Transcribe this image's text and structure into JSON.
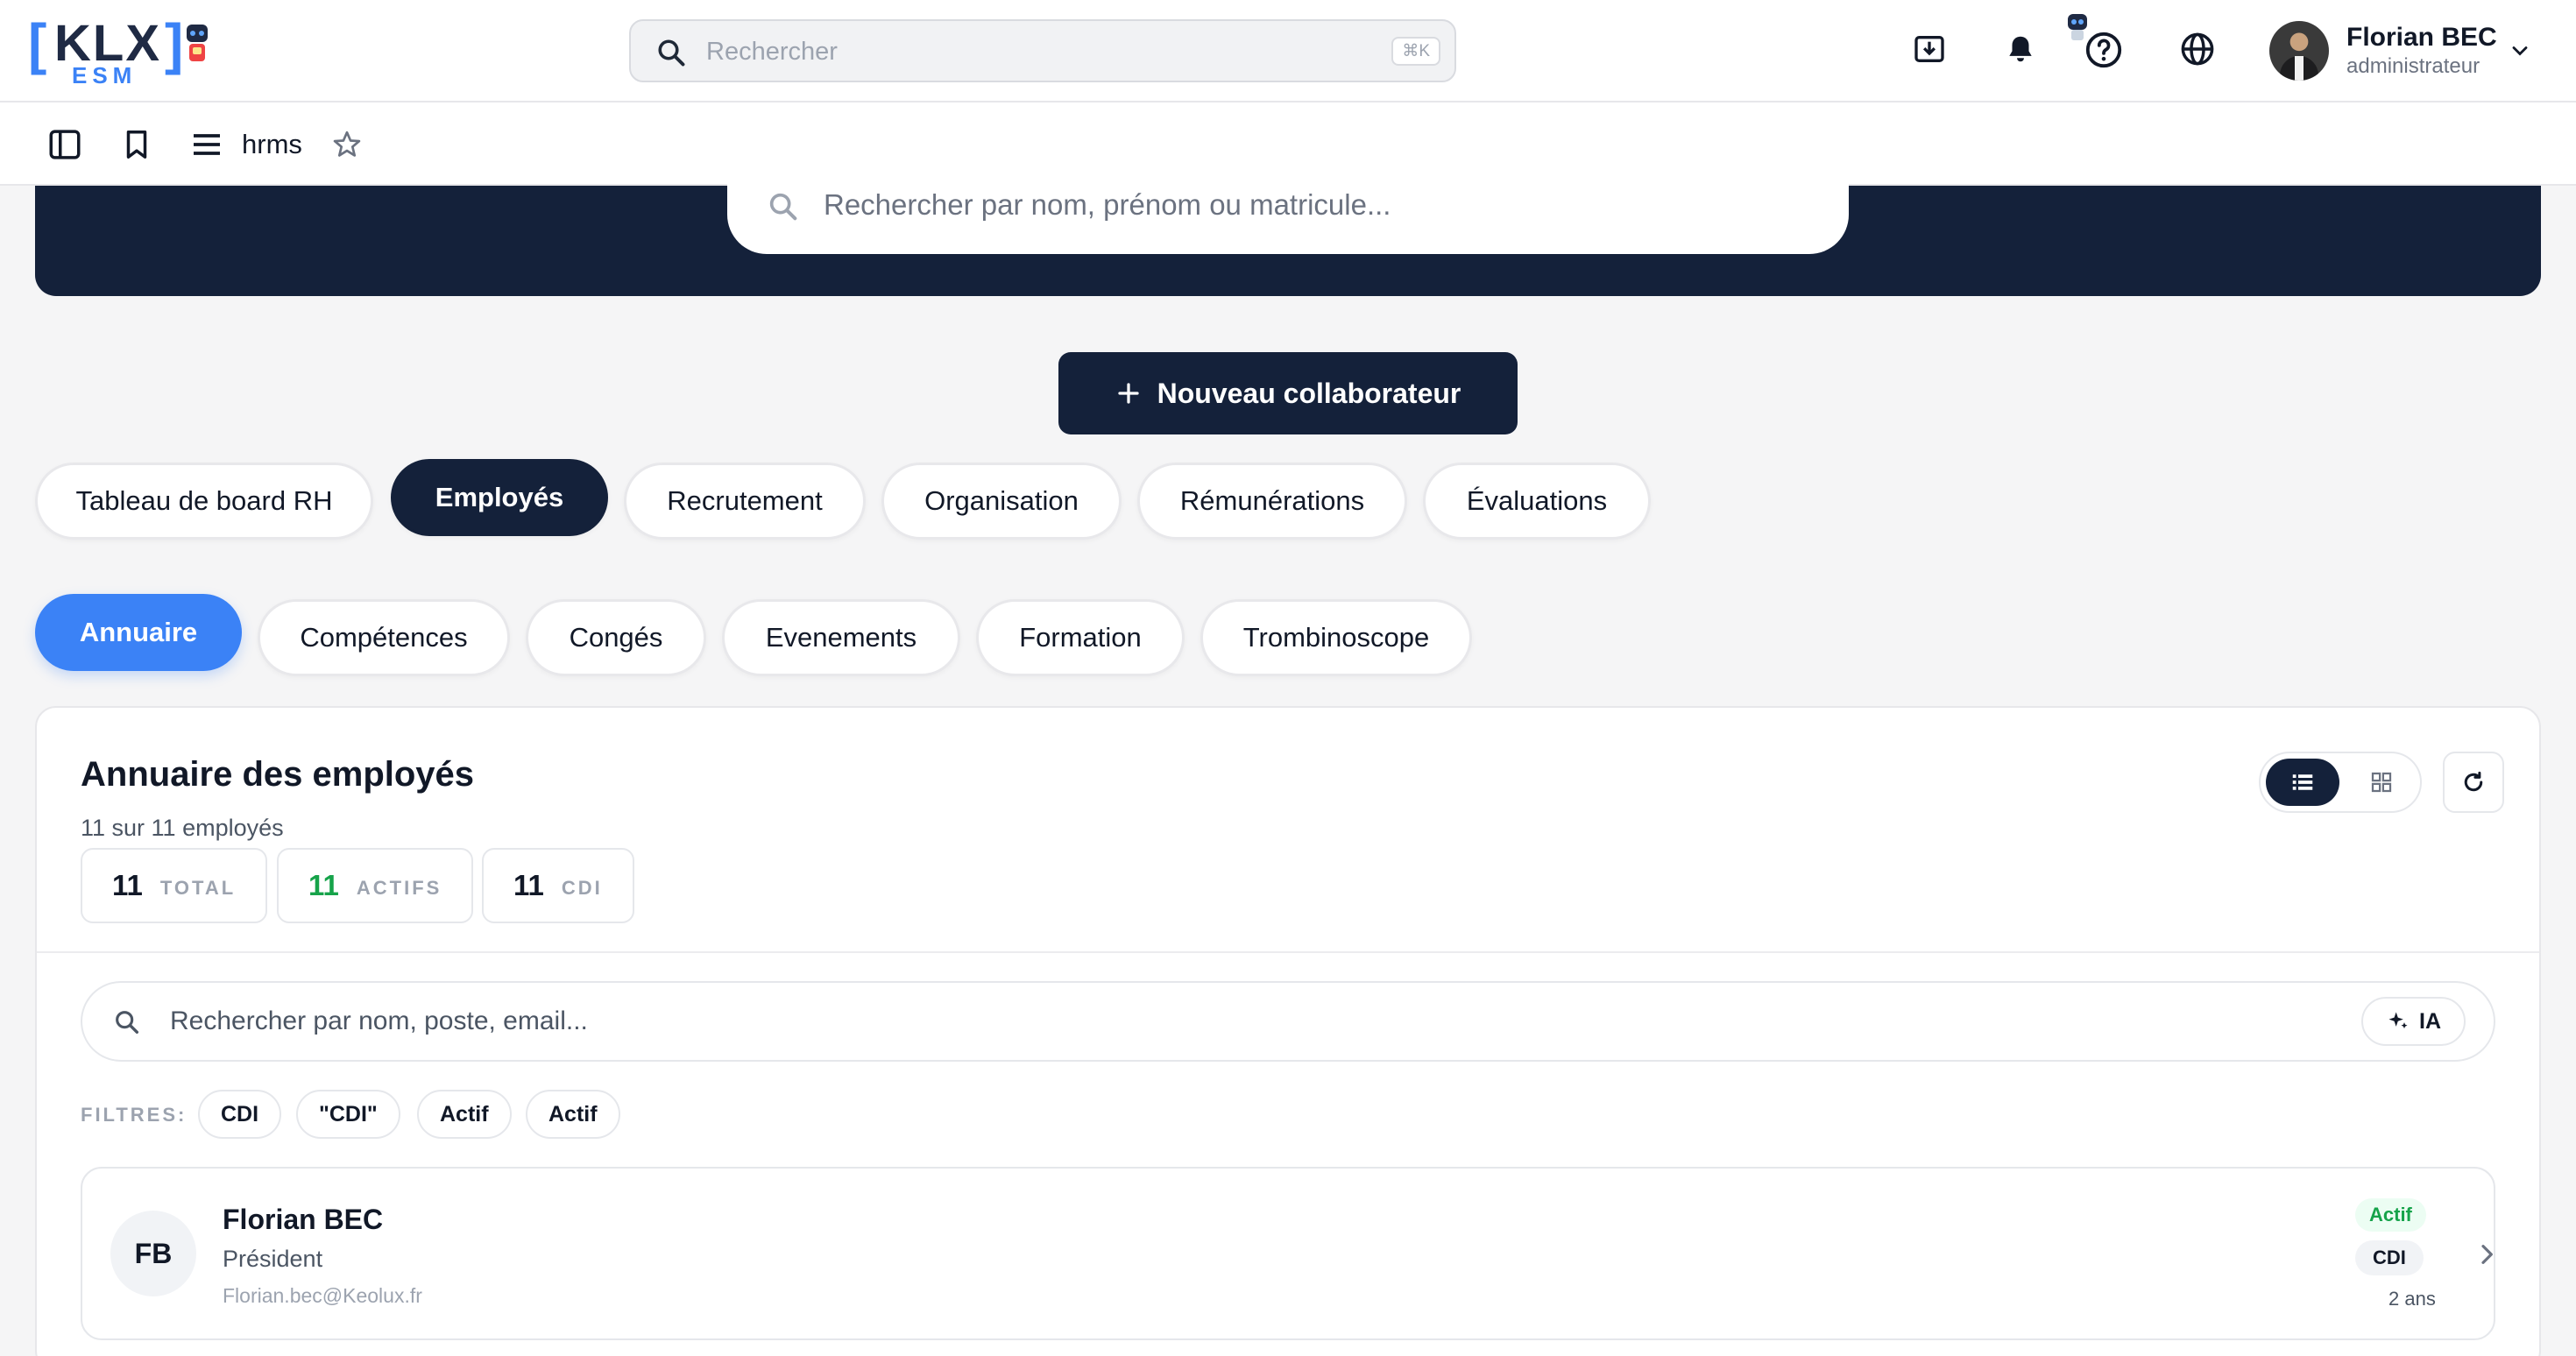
{
  "header": {
    "logo_text": "KLX",
    "logo_sub": "ESM",
    "search_placeholder": "Rechercher",
    "search_shortcut": "⌘K",
    "user_name": "Florian BEC",
    "user_role": "administrateur"
  },
  "toolbar": {
    "module_label": "hrms"
  },
  "hero": {
    "search_placeholder": "Rechercher par nom, prénom ou matricule..."
  },
  "actions": {
    "new_collaborator_label": "Nouveau collaborateur"
  },
  "main_tabs": [
    {
      "label": "Tableau de board RH"
    },
    {
      "label": "Employés"
    },
    {
      "label": "Recrutement"
    },
    {
      "label": "Organisation"
    },
    {
      "label": "Rémunérations"
    },
    {
      "label": "Évaluations"
    }
  ],
  "sub_tabs": [
    {
      "label": "Annuaire"
    },
    {
      "label": "Compétences"
    },
    {
      "label": "Congés"
    },
    {
      "label": "Evenements"
    },
    {
      "label": "Formation"
    },
    {
      "label": "Trombinoscope"
    }
  ],
  "directory": {
    "title": "Annuaire des employés",
    "subtitle": "11 sur 11 employés",
    "stats": [
      {
        "value": "11",
        "label": "TOTAL"
      },
      {
        "value": "11",
        "label": "ACTIFS"
      },
      {
        "value": "11",
        "label": "CDI"
      }
    ],
    "search_placeholder": "Rechercher par nom, poste, email...",
    "ia_label": "IA",
    "filters_label": "FILTRES:",
    "filters": [
      "CDI",
      "\"CDI\"",
      "Actif",
      "Actif"
    ],
    "employees": [
      {
        "initials": "FB",
        "name": "Florian BEC",
        "title": "Président",
        "email": "Florian.bec@Keolux.fr",
        "status": "Actif",
        "contract": "CDI",
        "seniority": "2 ans"
      }
    ]
  },
  "colors": {
    "navy": "#14213a",
    "accent_blue": "#3b82f6",
    "status_green": "#16a34a"
  },
  "icons": [
    "search-icon",
    "download-icon",
    "bell-icon",
    "help-icon",
    "robot-icon",
    "globe-icon",
    "chevron-down-icon",
    "sidebar-toggle-icon",
    "bookmark-icon",
    "menu-icon",
    "star-icon",
    "plus-icon",
    "list-view-icon",
    "grid-view-icon",
    "refresh-icon",
    "sparkle-icon",
    "chevron-right-icon"
  ]
}
